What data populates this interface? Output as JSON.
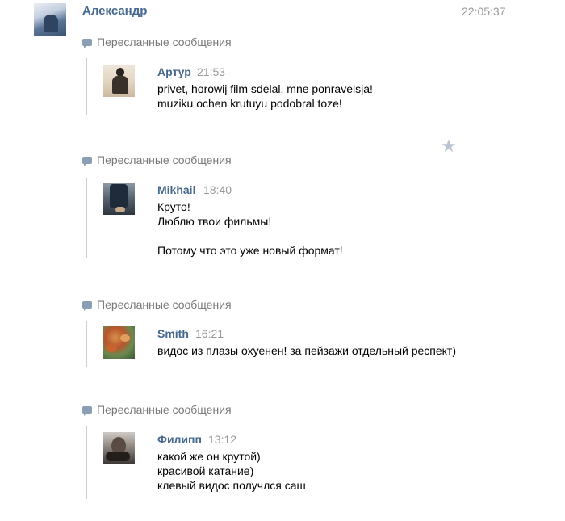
{
  "message": {
    "author_name": "Александр",
    "time": "22:05:37",
    "star_icon": "star-icon"
  },
  "forwarded_label": "Пересланные сообщения",
  "forwards": [
    {
      "name": "Артур",
      "time": "21:53",
      "lines": [
        "privet, horowij film sdelal, mne ponravelsja!",
        "muziku ochen krutuyu podobral toze!"
      ]
    },
    {
      "name": "Mikhail",
      "time": "18:40",
      "lines": [
        "Круто!",
        "Люблю твои фильмы!",
        "",
        "Потому что это уже новый формат!"
      ]
    },
    {
      "name": "Smith",
      "time": "16:21",
      "lines": [
        "видос из плазы охуенен! за пейзажи отдельный респект)"
      ]
    },
    {
      "name": "Филипп",
      "time": "13:12",
      "lines": [
        "какой же он крутой)",
        "красивой катание)",
        "клевый видос получлся саш"
      ]
    }
  ]
}
